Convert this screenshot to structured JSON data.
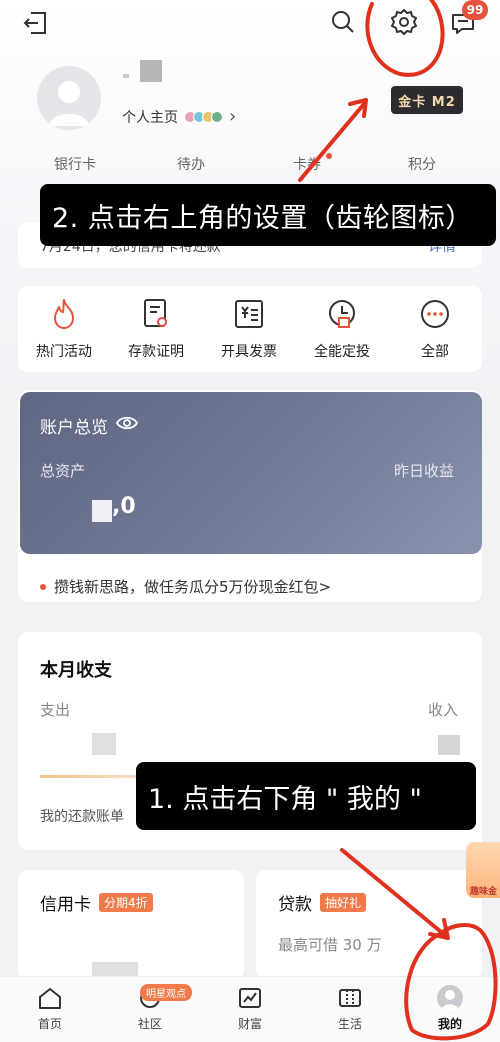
{
  "topbar": {
    "back_icon": "logout-icon",
    "search_icon": "search-icon",
    "settings_icon": "gear-icon",
    "message_icon": "message-icon",
    "message_badge": "99"
  },
  "profile": {
    "home_link": "个人主页",
    "chevron": "›",
    "card_level": "金卡 M2"
  },
  "quick_tabs": [
    "银行卡",
    "待办",
    "卡券",
    "积分"
  ],
  "notice": {
    "text": "7月24日，您的信用卡将还款",
    "link": "详情"
  },
  "services": [
    {
      "label": "热门活动",
      "icon": "fire-icon"
    },
    {
      "label": "存款证明",
      "icon": "certificate-icon"
    },
    {
      "label": "开具发票",
      "icon": "invoice-icon"
    },
    {
      "label": "全能定投",
      "icon": "investment-icon"
    },
    {
      "label": "全部",
      "icon": "more-icon"
    }
  ],
  "account": {
    "title": "账户总览",
    "total_assets_label": "总资产",
    "yesterday_income_label": "昨日收益",
    "total_assets_value": ",0",
    "promo": "攒钱新思路，做任务瓜分5万份现金红包>"
  },
  "monthly": {
    "title": "本月收支",
    "expense_label": "支出",
    "income_label": "收入",
    "repay_text": "我的还款账单"
  },
  "credit_card": {
    "title": "信用卡",
    "tag": "分期4折"
  },
  "loan": {
    "title": "贷款",
    "tag": "抽好礼",
    "subtitle": "最高可借 30 万"
  },
  "reward_float": "趣味金",
  "annotations": {
    "step1": "1. 点击右下角 \" 我的 \"",
    "step2": "2. 点击右上角的设置（齿轮图标）",
    "color": "#e0301e"
  },
  "bottom_nav": [
    {
      "label": "首页",
      "icon": "home-icon"
    },
    {
      "label": "社区",
      "icon": "community-icon",
      "badge": "明星观点"
    },
    {
      "label": "财富",
      "icon": "wealth-icon"
    },
    {
      "label": "生活",
      "icon": "life-icon"
    },
    {
      "label": "我的",
      "icon": "me-avatar-icon",
      "active": true
    }
  ]
}
